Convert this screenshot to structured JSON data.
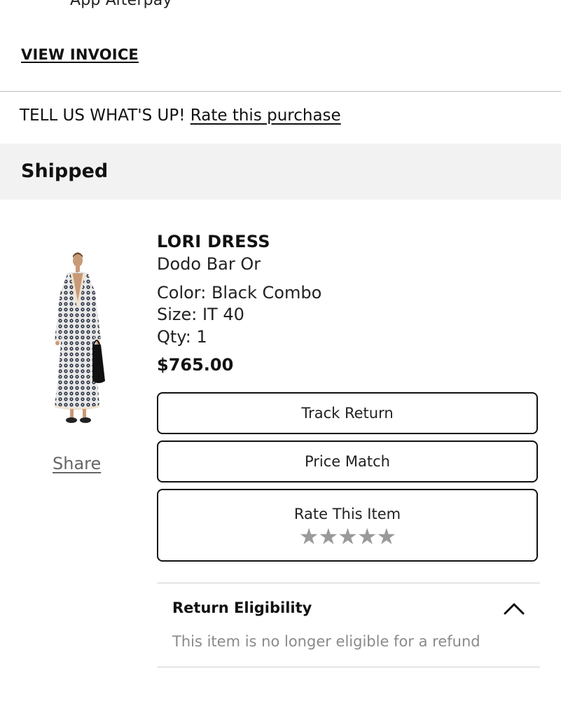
{
  "order": {
    "payment_method_text": "App Afterpay",
    "view_invoice_label": "VIEW INVOICE",
    "feedback_prompt": "TELL US WHAT'S UP!",
    "rate_purchase_label": "Rate this purchase",
    "status": "Shipped"
  },
  "item": {
    "name": "LORI DRESS",
    "brand": "Dodo Bar Or",
    "color_text": "Color: Black Combo",
    "size_text": "Size: IT 40",
    "qty_text": "Qty: 1",
    "price": "$765.00",
    "share_label": "Share",
    "image_icon": "dress-photo",
    "actions": {
      "track_return_label": "Track Return",
      "price_match_label": "Price Match",
      "rate_item_label": "Rate This Item",
      "rating_stars_filled": 0,
      "rating_stars_total": 5
    },
    "return_eligibility": {
      "title": "Return Eligibility",
      "message": "This item is no longer eligible for a refund",
      "expanded": true
    }
  },
  "colors": {
    "text_primary": "#111111",
    "text_muted": "#8a8a8a",
    "status_band": "#f2f2f2",
    "star_empty": "#9a9a9a"
  }
}
